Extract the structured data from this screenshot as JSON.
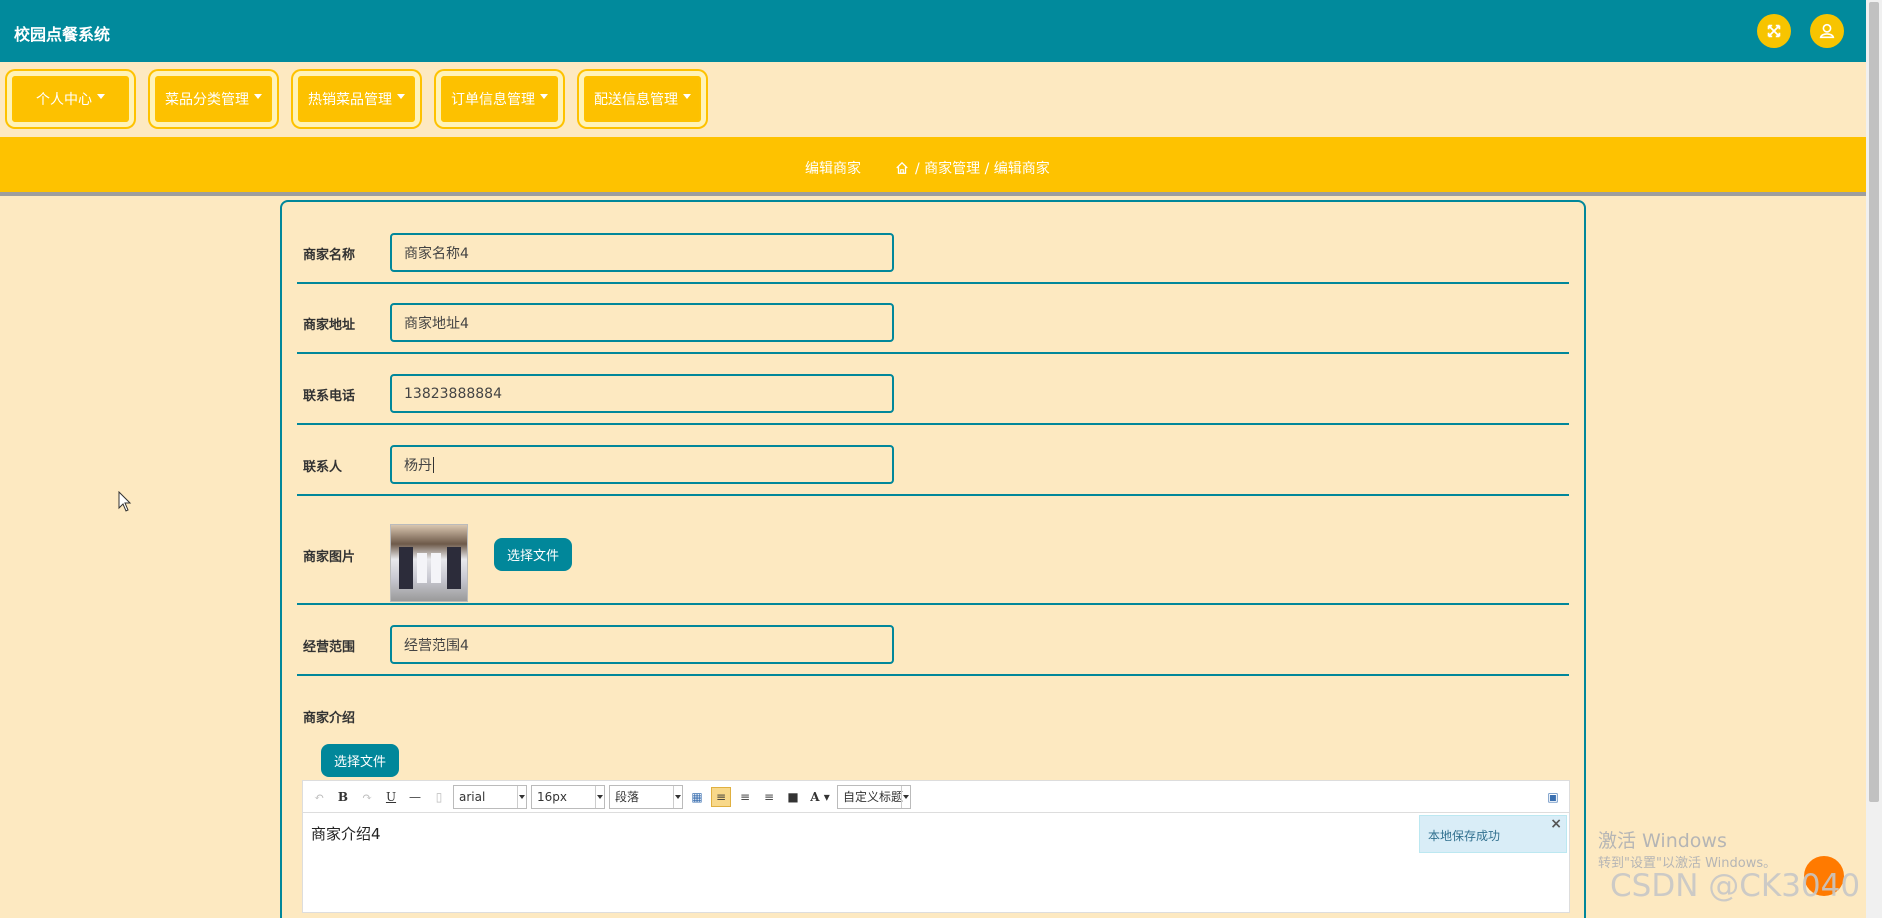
{
  "header": {
    "title": "校园点餐系统",
    "fullscreen_icon": "fullscreen-icon",
    "user_icon": "user-icon",
    "accent": "#018a9c",
    "button_color": "#f7c400"
  },
  "nav": {
    "items": [
      {
        "label": "个人中心"
      },
      {
        "label": "菜品分类管理"
      },
      {
        "label": "热销菜品管理"
      },
      {
        "label": "订单信息管理"
      },
      {
        "label": "配送信息管理"
      }
    ],
    "color": "#fec200"
  },
  "breadcrumb": {
    "title": "编辑商家",
    "home_icon": "home-icon",
    "path": "/ 商家管理 / 编辑商家"
  },
  "form": {
    "fields": [
      {
        "label": "商家名称",
        "value": "商家名称4"
      },
      {
        "label": "商家地址",
        "value": "商家地址4"
      },
      {
        "label": "联系电话",
        "value": "13823888884"
      },
      {
        "label": "联系人",
        "value": "杨丹"
      }
    ],
    "image_label": "商家图片",
    "choose_file": "选择文件",
    "scope_label": "经营范围",
    "scope_value": "经营范围4",
    "intro_label": "商家介绍",
    "intro_choose_file": "选择文件"
  },
  "editor": {
    "font": "arial",
    "size": "16px",
    "paragraph": "段落",
    "custom_title": "自定义标题",
    "content": "商家介绍4",
    "toast": "本地保存成功"
  },
  "watermark": {
    "line1": "激活 Windows",
    "line2": "转到\"设置\"以激活 Windows。",
    "csdn": "CSDN @CK3040"
  }
}
